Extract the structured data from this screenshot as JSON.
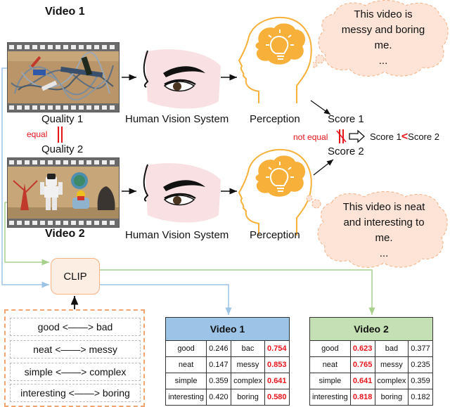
{
  "video1": {
    "title": "Video 1",
    "quality_label": "Quality 1",
    "scene": "messy-cables-in-wooden-box"
  },
  "video2": {
    "title": "Video 2",
    "quality_label": "Quality 2",
    "scene": "toys-robot-figures-on-shelf"
  },
  "equal_label": "equal",
  "hvs_label": "Human Vision System",
  "perception_label": "Perception",
  "score1_label": "Score 1",
  "score2_label": "Score 2",
  "not_equal_label": "not equal",
  "comparison": {
    "left": "Score 1",
    "operator": "<",
    "right": "Score 2"
  },
  "thought1": {
    "lines": [
      "This video is",
      "messy and boring",
      "me.",
      "..."
    ]
  },
  "thought2": {
    "lines": [
      "This video is neat",
      "and interesting to",
      "me.",
      "..."
    ]
  },
  "clip_label": "CLIP",
  "prompts": [
    "good <——> bad",
    "neat <——> messy",
    "simple <——> complex",
    "interesting <——> boring"
  ],
  "colors": {
    "video1_header": "#9dc3e6",
    "video2_header": "#c5e0b4",
    "blue_line": "#9dc3e6",
    "green_line": "#a9d18e",
    "highlight_red": "#e8141c",
    "head_orange": "#f7b13a",
    "cloud_fill": "#fde4d7",
    "clip_border": "#f4b183"
  },
  "table1": {
    "title": "Video 1",
    "rows": [
      {
        "pos": "good",
        "pos_val": "0.246",
        "neg": "bac",
        "neg_val": "0.754",
        "highlight": "neg"
      },
      {
        "pos": "neat",
        "pos_val": "0.147",
        "neg": "messy",
        "neg_val": "0.853",
        "highlight": "neg"
      },
      {
        "pos": "simple",
        "pos_val": "0.359",
        "neg": "complex",
        "neg_val": "0.641",
        "highlight": "neg"
      },
      {
        "pos": "interesting",
        "pos_val": "0.420",
        "neg": "boring",
        "neg_val": "0.580",
        "highlight": "neg"
      }
    ]
  },
  "table2": {
    "title": "Video 2",
    "rows": [
      {
        "pos": "good",
        "pos_val": "0.623",
        "neg": "bad",
        "neg_val": "0.377",
        "highlight": "pos"
      },
      {
        "pos": "neat",
        "pos_val": "0.765",
        "neg": "messy",
        "neg_val": "0.235",
        "highlight": "pos"
      },
      {
        "pos": "simple",
        "pos_val": "0.641",
        "neg": "complex",
        "neg_val": "0.359",
        "highlight": "pos"
      },
      {
        "pos": "interesting",
        "pos_val": "0.818",
        "neg": "boring",
        "neg_val": "0.182",
        "highlight": "pos"
      }
    ]
  }
}
